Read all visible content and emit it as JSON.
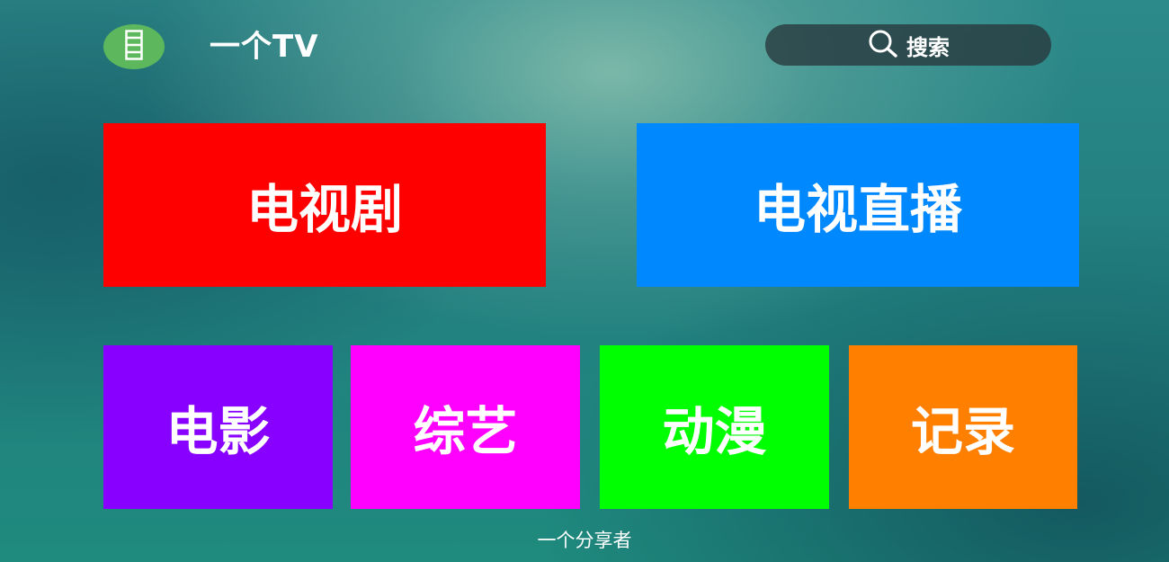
{
  "header": {
    "app_title": "一个TV",
    "search_label": "搜索",
    "logo_icon": "film-strip-icon",
    "search_icon": "search-icon"
  },
  "tiles": [
    {
      "label": "电视剧",
      "color": "#ff0000"
    },
    {
      "label": "电视直播",
      "color": "#0088ff"
    },
    {
      "label": "电影",
      "color": "#8800ff"
    },
    {
      "label": "综艺",
      "color": "#ff00ff"
    },
    {
      "label": "动漫",
      "color": "#00ff00"
    },
    {
      "label": "记录",
      "color": "#ff8000"
    }
  ],
  "footer": {
    "text": "一个分享者"
  },
  "colors": {
    "logo_bg": "#5db85d",
    "search_bg": "#28373c",
    "text": "#ffffff"
  }
}
